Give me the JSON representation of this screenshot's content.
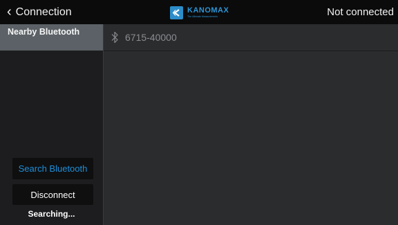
{
  "header": {
    "back_label": "Connection",
    "logo_name": "KANOMAX",
    "logo_tagline": "The Ultimate Measurements",
    "status": "Not connected"
  },
  "sidebar": {
    "items": [
      {
        "label": "Nearby Bluetooth"
      }
    ],
    "search_button": "Search Bluetooth",
    "disconnect_button": "Disconnect",
    "status_text": "Searching..."
  },
  "devices": [
    {
      "icon": "bluetooth-icon",
      "name": "6715-40000"
    }
  ],
  "colors": {
    "accent": "#1d8fd8",
    "topbar": "#0b0b0c",
    "sidebar": "#1d1d1f",
    "selected_item": "#5b6166",
    "main_bg": "#2b2c2e"
  }
}
